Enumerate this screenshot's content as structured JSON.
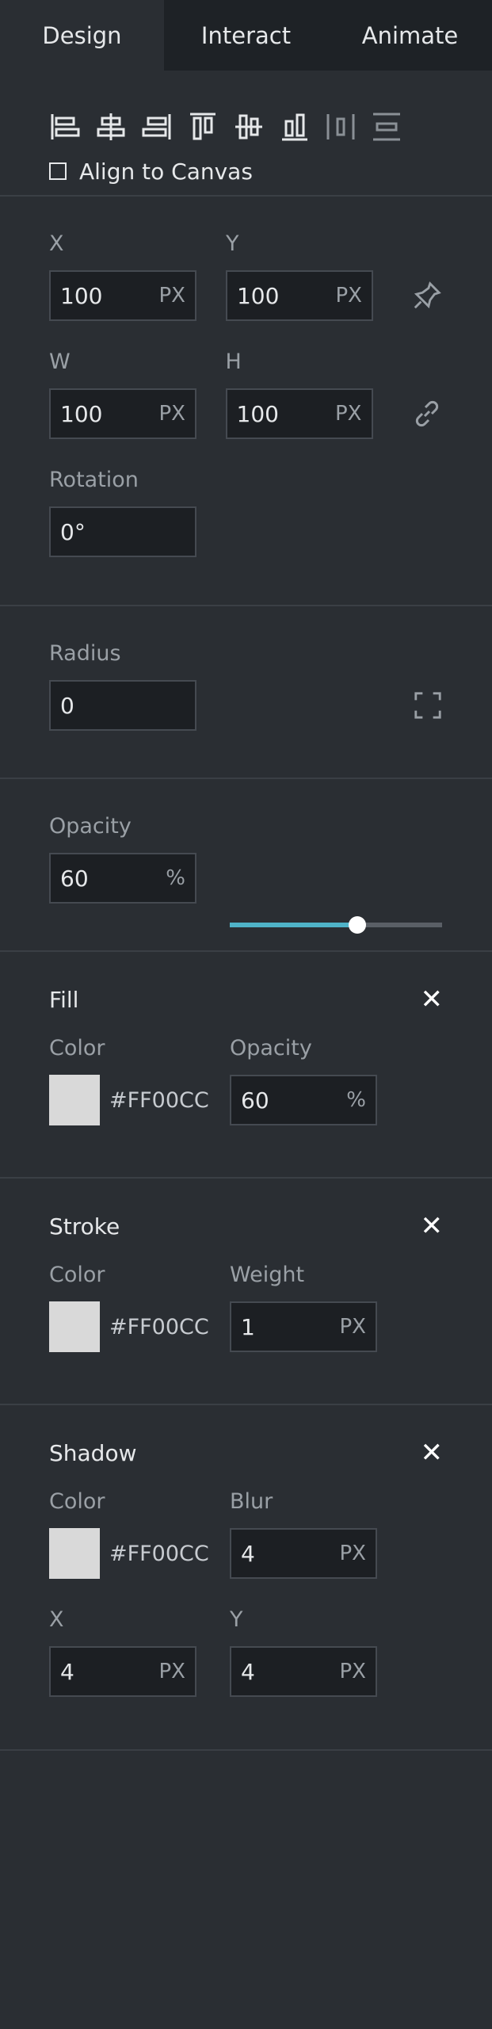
{
  "tabs": [
    {
      "label": "Design"
    },
    {
      "label": "Interact"
    },
    {
      "label": "Animate"
    }
  ],
  "align": {
    "icons": [
      "align-left-icon",
      "align-center-horizontal-icon",
      "align-right-icon",
      "align-top-icon",
      "align-center-vertical-icon",
      "align-bottom-icon",
      "distribute-horizontal-icon",
      "distribute-vertical-icon"
    ],
    "canvas_label": "Align to Canvas"
  },
  "transform": {
    "x_label": "X",
    "x_value": "100",
    "x_unit": "PX",
    "y_label": "Y",
    "y_value": "100",
    "y_unit": "PX",
    "w_label": "W",
    "w_value": "100",
    "w_unit": "PX",
    "h_label": "H",
    "h_value": "100",
    "h_unit": "PX",
    "rotation_label": "Rotation",
    "rotation_value": "0°"
  },
  "radius": {
    "label": "Radius",
    "value": "0"
  },
  "opacity": {
    "label": "Opacity",
    "value": "60",
    "unit": "%",
    "slider_fraction": 0.6
  },
  "fill": {
    "title": "Fill",
    "color_label": "Color",
    "color_hex": "#FF00CC",
    "opacity_label": "Opacity",
    "opacity_value": "60",
    "opacity_unit": "%"
  },
  "stroke": {
    "title": "Stroke",
    "color_label": "Color",
    "color_hex": "#FF00CC",
    "weight_label": "Weight",
    "weight_value": "1",
    "weight_unit": "PX"
  },
  "shadow": {
    "title": "Shadow",
    "color_label": "Color",
    "color_hex": "#FF00CC",
    "blur_label": "Blur",
    "blur_value": "4",
    "blur_unit": "PX",
    "x_label": "X",
    "x_value": "4",
    "x_unit": "PX",
    "y_label": "Y",
    "y_value": "4",
    "y_unit": "PX"
  },
  "close_glyph": "✕",
  "colors": {
    "accent": "#4fb3c8",
    "swatch": "#d9d9d9",
    "background": "#2a2e33"
  }
}
